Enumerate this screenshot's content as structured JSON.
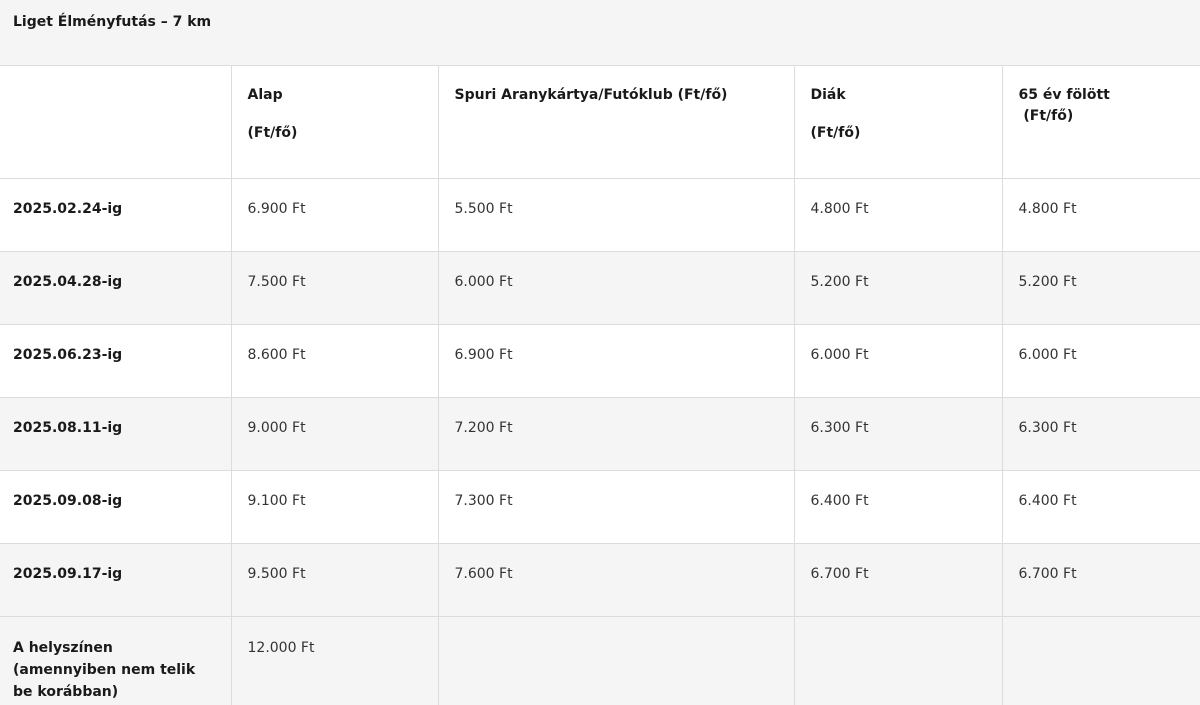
{
  "title": "Liget Élményfutás – 7 km",
  "headers": {
    "col1": {
      "name": "Alap",
      "unit": "(Ft/fő)"
    },
    "col2": {
      "name": "Spuri Aranykártya/Futóklub (Ft/fő)"
    },
    "col3": {
      "name": "Diák",
      "unit": "(Ft/fő)"
    },
    "col4": {
      "name": "65 év fölött",
      "unit": " (Ft/fő)"
    }
  },
  "rows": [
    {
      "period": "2025.02.24-ig",
      "alap": "6.900 Ft",
      "spuri": "5.500 Ft",
      "diak": "4.800 Ft",
      "senior": "4.800 Ft"
    },
    {
      "period": "2025.04.28-ig",
      "alap": "7.500 Ft",
      "spuri": "6.000 Ft",
      "diak": "5.200 Ft",
      "senior": "5.200 Ft"
    },
    {
      "period": "2025.06.23-ig",
      "alap": "8.600 Ft",
      "spuri": "6.900 Ft",
      "diak": "6.000 Ft",
      "senior": "6.000 Ft"
    },
    {
      "period": "2025.08.11-ig",
      "alap": "9.000 Ft",
      "spuri": "7.200 Ft",
      "diak": "6.300 Ft",
      "senior": "6.300 Ft"
    },
    {
      "period": "2025.09.08-ig",
      "alap": "9.100 Ft",
      "spuri": "7.300 Ft",
      "diak": "6.400 Ft",
      "senior": "6.400 Ft"
    },
    {
      "period": "2025.09.17-ig",
      "alap": "9.500 Ft",
      "spuri": "7.600 Ft",
      "diak": "6.700 Ft",
      "senior": "6.700 Ft"
    }
  ],
  "onsite": {
    "period": "A helyszínen (amennyiben nem telik be korábban)",
    "alap": "12.000 Ft"
  }
}
